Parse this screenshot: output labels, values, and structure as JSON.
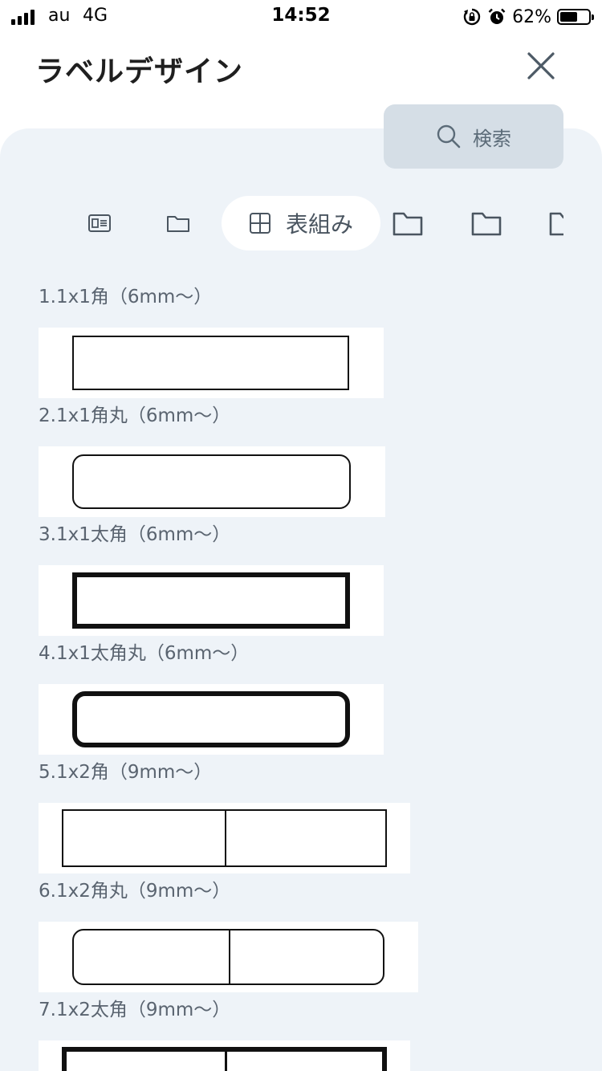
{
  "status_bar": {
    "carrier": "au",
    "network": "4G",
    "time": "14:52",
    "battery_percent": "62%",
    "battery_level": 0.62,
    "icons": [
      "signal-icon",
      "rotation-lock-icon",
      "alarm-icon",
      "battery-icon"
    ]
  },
  "header": {
    "title": "ラベルデザイン",
    "close_icon": "close-icon"
  },
  "search": {
    "label": "検索",
    "icon": "search-icon"
  },
  "tabs": [
    {
      "icon": "id-card-icon",
      "label": "",
      "active": false
    },
    {
      "icon": "folder-icon",
      "label": "",
      "active": false
    },
    {
      "icon": "table-grid-icon",
      "label": "表組み",
      "active": true
    },
    {
      "icon": "folder-icon",
      "label": "",
      "active": false
    },
    {
      "icon": "folder-icon",
      "label": "",
      "active": false
    },
    {
      "icon": "folder-icon",
      "label": "",
      "active": false
    }
  ],
  "designs": [
    {
      "label": "1.1x1角（6mm〜）",
      "style": "square",
      "cells": 1
    },
    {
      "label": "2.1x1角丸（6mm〜）",
      "style": "rounded",
      "cells": 1
    },
    {
      "label": "3.1x1太角（6mm〜）",
      "style": "bold-square",
      "cells": 1
    },
    {
      "label": "4.1x1太角丸（6mm〜）",
      "style": "bold-rounded",
      "cells": 1
    },
    {
      "label": "5.1x2角（9mm〜）",
      "style": "square",
      "cells": 2
    },
    {
      "label": "6.1x2角丸（9mm〜）",
      "style": "rounded",
      "cells": 2
    },
    {
      "label": "7.1x2太角（9mm〜）",
      "style": "bold-square",
      "cells": 2
    }
  ],
  "colors": {
    "panel_background": "#eef3f8",
    "search_background": "#d5dee6",
    "label_text": "#5a6470",
    "shape_stroke": "#111111"
  }
}
